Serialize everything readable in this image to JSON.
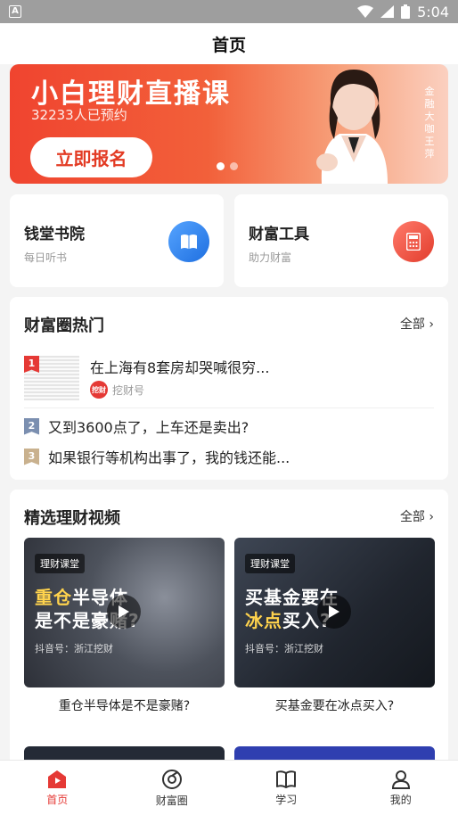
{
  "status_bar": {
    "time": "5:04",
    "left_icon": "A"
  },
  "header": {
    "title": "首页"
  },
  "banner": {
    "title": "小白理财直播课",
    "subtitle": "32233人已预约",
    "button_label": "立即报名",
    "vertical_text": "金融大咖 王萍"
  },
  "features": [
    {
      "title": "钱堂书院",
      "subtitle": "每日听书",
      "icon": "book-icon",
      "color": "#2f80ed"
    },
    {
      "title": "财富工具",
      "subtitle": "助力财富",
      "icon": "calculator-icon",
      "color": "#ef4c3c"
    }
  ],
  "hot": {
    "title": "财富圈热门",
    "all_label": "全部",
    "items": [
      {
        "rank": "1",
        "title": "在上海有8套房却哭喊很穷...",
        "source_logo": "挖财",
        "source": "挖财号"
      },
      {
        "rank": "2",
        "title": "又到3600点了，上车还是卖出?"
      },
      {
        "rank": "3",
        "title": "如果银行等机构出事了，我的钱还能..."
      }
    ]
  },
  "videos": {
    "title": "精选理财视频",
    "all_label": "全部",
    "items": [
      {
        "tag": "理财课堂",
        "line1_a": "重仓",
        "line1_b": "半导体",
        "line2_a": "是不是",
        "line2_b": "豪赌?",
        "source": "抖音号：浙江挖财",
        "caption": "重仓半导体是不是豪赌?"
      },
      {
        "tag": "理财课堂",
        "line1_a": "买基金要在",
        "line1_b": "",
        "line2_a": "冰点",
        "line2_b": "买入?",
        "source": "抖音号：浙江挖财",
        "caption": "买基金要在冰点买入?"
      }
    ]
  },
  "tabbar": {
    "items": [
      {
        "label": "首页",
        "icon": "home-icon",
        "active": true
      },
      {
        "label": "财富圈",
        "icon": "compass-icon",
        "active": false
      },
      {
        "label": "学习",
        "icon": "open-book-icon",
        "active": false
      },
      {
        "label": "我的",
        "icon": "person-icon",
        "active": false
      }
    ]
  },
  "colors": {
    "accent": "#e53935",
    "banner": "#f0442f"
  }
}
